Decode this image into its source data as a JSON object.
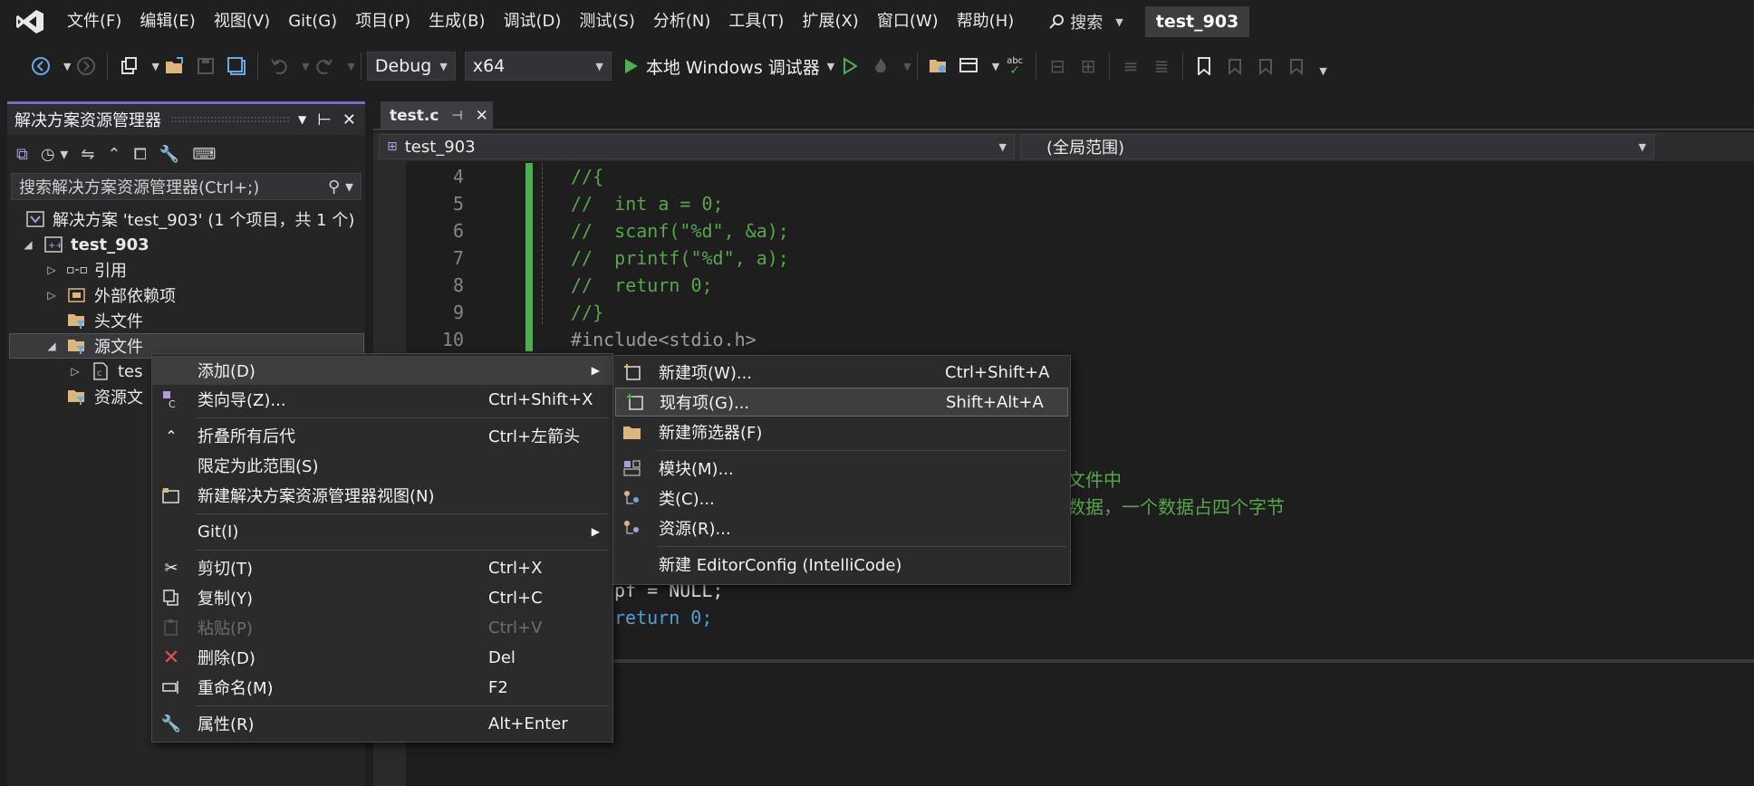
{
  "menubar": {
    "items": [
      "文件(F)",
      "编辑(E)",
      "视图(V)",
      "Git(G)",
      "项目(P)",
      "生成(B)",
      "调试(D)",
      "测试(S)",
      "分析(N)",
      "工具(T)",
      "扩展(X)",
      "窗口(W)",
      "帮助(H)"
    ],
    "search_label": "搜索",
    "solution_title": "test_903"
  },
  "toolbar": {
    "config": "Debug",
    "platform": "x64",
    "debugger_label": "本地 Windows 调试器"
  },
  "solution_explorer": {
    "title": "解决方案资源管理器",
    "search_placeholder": "搜索解决方案资源管理器(Ctrl+;)",
    "tree": {
      "solution": "解决方案 'test_903' (1 个项目，共 1 个)",
      "project": "test_903",
      "references": "引用",
      "external_deps": "外部依赖项",
      "headers": "头文件",
      "sources": "源文件",
      "source_file": "tes",
      "resources": "资源文"
    }
  },
  "editor": {
    "tab_name": "test.c",
    "nav_project": "test_903",
    "nav_scope": "(全局范围)",
    "lines": [
      {
        "num": "4",
        "text": "//{"
      },
      {
        "num": "5",
        "text": "//  int a = 0;"
      },
      {
        "num": "6",
        "text": "//  scanf(\"%d\", &a);"
      },
      {
        "num": "7",
        "text": "//  printf(\"%d\", a);"
      },
      {
        "num": "8",
        "text": "//  return 0;"
      },
      {
        "num": "9",
        "text": "//}"
      },
      {
        "num": "10",
        "text": "#include<stdio.h>"
      }
    ],
    "fragment_comment_1": "文件中",
    "fragment_comment_2": "数据，一个数据占四个字节",
    "fragment_code_1": "pf = NULL;",
    "fragment_code_2": "return 0;"
  },
  "context_menu": {
    "items": [
      {
        "label": "添加(D)",
        "shortcut": "",
        "submenu": true
      },
      {
        "label": "类向导(Z)...",
        "shortcut": "Ctrl+Shift+X"
      },
      {
        "label": "折叠所有后代",
        "shortcut": "Ctrl+左箭头"
      },
      {
        "label": "限定为此范围(S)",
        "shortcut": ""
      },
      {
        "label": "新建解决方案资源管理器视图(N)",
        "shortcut": ""
      },
      {
        "label": "Git(I)",
        "shortcut": "",
        "submenu": true
      },
      {
        "label": "剪切(T)",
        "shortcut": "Ctrl+X"
      },
      {
        "label": "复制(Y)",
        "shortcut": "Ctrl+C"
      },
      {
        "label": "粘贴(P)",
        "shortcut": "Ctrl+V",
        "disabled": true
      },
      {
        "label": "删除(D)",
        "shortcut": "Del"
      },
      {
        "label": "重命名(M)",
        "shortcut": "F2"
      },
      {
        "label": "属性(R)",
        "shortcut": "Alt+Enter"
      }
    ]
  },
  "add_submenu": {
    "items": [
      {
        "label": "新建项(W)...",
        "shortcut": "Ctrl+Shift+A"
      },
      {
        "label": "现有项(G)...",
        "shortcut": "Shift+Alt+A"
      },
      {
        "label": "新建筛选器(F)",
        "shortcut": ""
      },
      {
        "label": "模块(M)...",
        "shortcut": ""
      },
      {
        "label": "类(C)...",
        "shortcut": ""
      },
      {
        "label": "资源(R)...",
        "shortcut": ""
      },
      {
        "label": "新建 EditorConfig (IntelliCode)",
        "shortcut": ""
      }
    ]
  },
  "colors": {
    "accent": "#7b68c8",
    "comment": "#57a64a",
    "keyword_blue": "#569cd6",
    "string": "#d69d85",
    "green_bar": "#4caf50"
  }
}
